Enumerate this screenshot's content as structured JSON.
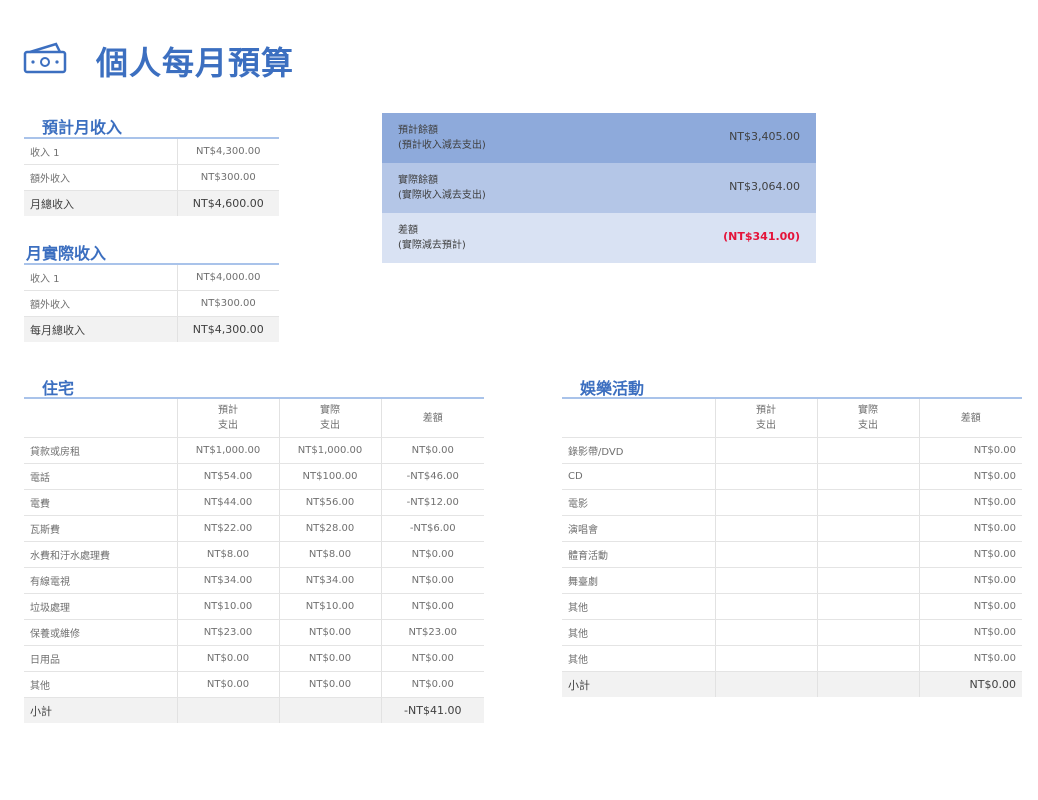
{
  "page_title": "個人每月預算",
  "projected_income": {
    "title": "預計月收入",
    "rows": [
      {
        "label": "收入 1",
        "value": "NT$4,300.00"
      },
      {
        "label": "額外收入",
        "value": "NT$300.00"
      }
    ],
    "total": {
      "label": "月總收入",
      "value": "NT$4,600.00"
    }
  },
  "actual_income": {
    "title": "月實際收入",
    "rows": [
      {
        "label": "收入 1",
        "value": "NT$4,000.00"
      },
      {
        "label": "額外收入",
        "value": "NT$300.00"
      }
    ],
    "total": {
      "label": "每月總收入",
      "value": "NT$4,300.00"
    }
  },
  "summary": [
    {
      "label1": "預計餘額",
      "label2": "(預計收入減去支出)",
      "value": "NT$3,405.00",
      "bg": "#8eaadb"
    },
    {
      "label1": "實際餘額",
      "label2": "(實際收入減去支出)",
      "value": "NT$3,064.00",
      "bg": "#b4c6e7"
    },
    {
      "label1": "差額",
      "label2": "(實際減去預計)",
      "value": "(NT$341.00)",
      "bg": "#d9e2f3"
    }
  ],
  "housing": {
    "title": "住宅",
    "headers": {
      "projected": "預計\n支出",
      "actual": "實際\n支出",
      "diff": "差額"
    },
    "rows": [
      {
        "label": "貸款或房租",
        "projected": "NT$1,000.00",
        "actual": "NT$1,000.00",
        "diff": "NT$0.00"
      },
      {
        "label": "電話",
        "projected": "NT$54.00",
        "actual": "NT$100.00",
        "diff": "-NT$46.00"
      },
      {
        "label": "電費",
        "projected": "NT$44.00",
        "actual": "NT$56.00",
        "diff": "-NT$12.00"
      },
      {
        "label": "瓦斯費",
        "projected": "NT$22.00",
        "actual": "NT$28.00",
        "diff": "-NT$6.00"
      },
      {
        "label": "水費和汙水處理費",
        "projected": "NT$8.00",
        "actual": "NT$8.00",
        "diff": "NT$0.00"
      },
      {
        "label": "有線電視",
        "projected": "NT$34.00",
        "actual": "NT$34.00",
        "diff": "NT$0.00"
      },
      {
        "label": "垃圾處理",
        "projected": "NT$10.00",
        "actual": "NT$10.00",
        "diff": "NT$0.00"
      },
      {
        "label": "保養或維修",
        "projected": "NT$23.00",
        "actual": "NT$0.00",
        "diff": "NT$23.00"
      },
      {
        "label": "日用品",
        "projected": "NT$0.00",
        "actual": "NT$0.00",
        "diff": "NT$0.00"
      },
      {
        "label": "其他",
        "projected": "NT$0.00",
        "actual": "NT$0.00",
        "diff": "NT$0.00"
      }
    ],
    "total": {
      "label": "小計",
      "diff": "-NT$41.00"
    }
  },
  "entertainment": {
    "title": "娛樂活動",
    "headers": {
      "projected": "預計\n支出",
      "actual": "實際\n支出",
      "diff": "差額"
    },
    "rows": [
      {
        "label": "錄影帶/DVD",
        "diff": "NT$0.00"
      },
      {
        "label": "CD",
        "diff": "NT$0.00"
      },
      {
        "label": "電影",
        "diff": "NT$0.00"
      },
      {
        "label": "演唱會",
        "diff": "NT$0.00"
      },
      {
        "label": "體育活動",
        "diff": "NT$0.00"
      },
      {
        "label": "舞臺劇",
        "diff": "NT$0.00"
      },
      {
        "label": "其他",
        "diff": "NT$0.00"
      },
      {
        "label": "其他",
        "diff": "NT$0.00"
      },
      {
        "label": "其他",
        "diff": "NT$0.00"
      }
    ],
    "total": {
      "label": "小計",
      "diff": "NT$0.00"
    }
  }
}
